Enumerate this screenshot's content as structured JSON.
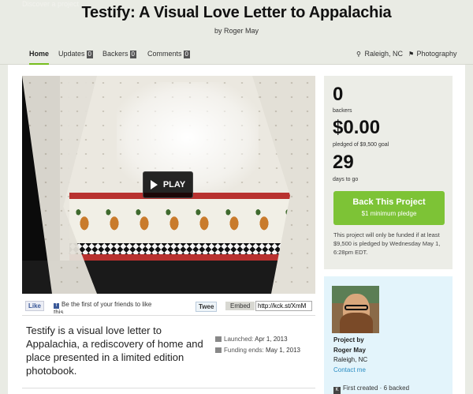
{
  "topbar": {
    "ghost_text": "Discover a project"
  },
  "header": {
    "title": "Testify: A Visual Love Letter to Appalachia",
    "byline": "by Roger May"
  },
  "subnav": {
    "tabs": [
      {
        "label": "Home",
        "count": null,
        "active": true
      },
      {
        "label": "Updates",
        "count": "0",
        "active": false
      },
      {
        "label": "Backers",
        "count": "0",
        "active": false
      },
      {
        "label": "Comments",
        "count": "0",
        "active": false
      }
    ],
    "location": "Raleigh, NC",
    "category": "Photography"
  },
  "video": {
    "play_label": "PLAY"
  },
  "social": {
    "like_label": "Like",
    "fb_text": "Be the first of your friends to like this.",
    "tweet_label": "Twee",
    "embed_label": "Embed",
    "short_url": "http://kck.st/XmM"
  },
  "blurb": "Testify is a visual love letter to Appalachia, a rediscovery of home and place presented in a limited edition photobook.",
  "dates": {
    "launched_label": "Launched:",
    "launched_value": "Apr 1, 2013",
    "ends_label": "Funding ends:",
    "ends_value": "May 1, 2013"
  },
  "stats": {
    "backers_value": "0",
    "backers_label": "backers",
    "pledged_value": "$0.00",
    "pledged_label": "pledged of $9,500 goal",
    "days_value": "29",
    "days_label": "days to go",
    "back_button": "Back This Project",
    "back_sub": "$1 minimum pledge",
    "note": "This project will only be funded if at least $9,500 is pledged by Wednesday May 1, 6:28pm EDT."
  },
  "creator": {
    "project_by_label": "Project by",
    "name": "Roger May",
    "location": "Raleigh, NC",
    "contact_label": "Contact me",
    "history": "First created · 6 backed"
  },
  "colors": {
    "accent_green": "#7dc336",
    "tab_underline": "#76bd1d",
    "link_blue": "#2a8dc3",
    "creator_bg": "#e3f4fb"
  },
  "icons": [
    "location-pin-icon",
    "tag-icon",
    "play-icon",
    "calendar-icon",
    "facebook-icon",
    "kickstarter-icon"
  ]
}
